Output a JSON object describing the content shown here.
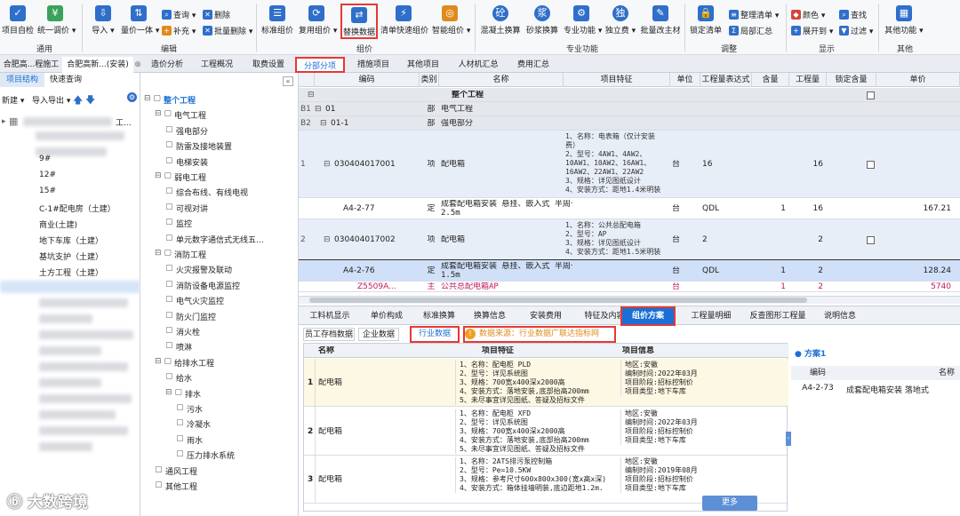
{
  "ribbon": {
    "buttons": [
      {
        "label": "项目自检",
        "icon": "check-icon"
      },
      {
        "label": "统一调价 ▾",
        "icon": "price-icon"
      },
      {
        "label": "导入 ▾",
        "icon": "import-icon"
      },
      {
        "label": "量价一体 ▾",
        "icon": "price-volume-icon"
      },
      {
        "label": "标准组价",
        "icon": "standard-pricing-icon"
      },
      {
        "label": "复用组价 ▾",
        "icon": "reuse-icon"
      },
      {
        "label": "替换数据",
        "icon": "replace-icon"
      },
      {
        "label": "清单快速组价",
        "icon": "quick-pricing-icon"
      },
      {
        "label": "智能组价 ▾",
        "icon": "smart-pricing-icon"
      },
      {
        "label": "混凝土换算",
        "icon": "concrete-icon"
      },
      {
        "label": "砂浆换算",
        "icon": "mortar-icon"
      },
      {
        "label": "专业功能 ▾",
        "icon": "pro-icon"
      },
      {
        "label": "独立费 ▾",
        "icon": "fee-icon"
      },
      {
        "label": "批量改主材",
        "icon": "batch-material-icon"
      },
      {
        "label": "锁定清单",
        "icon": "lock-icon"
      },
      {
        "label": "其他功能 ▾",
        "icon": "more-functions-icon"
      }
    ],
    "small": [
      {
        "label": "查询 ▾",
        "icon": "query-icon"
      },
      {
        "label": "删除",
        "icon": "delete-icon"
      },
      {
        "label": "补充 ▾",
        "icon": "supplement-icon"
      },
      {
        "label": "批量删除 ▾",
        "icon": "batch-delete-icon"
      },
      {
        "label": "整理清单 ▾",
        "icon": "organize-icon"
      },
      {
        "label": "局部汇总",
        "icon": "summary-icon"
      },
      {
        "label": "颜色 ▾",
        "icon": "color-icon"
      },
      {
        "label": "查找",
        "icon": "search-icon"
      },
      {
        "label": "展开到 ▾",
        "icon": "expand-icon"
      },
      {
        "label": "过滤 ▾",
        "icon": "filter-icon"
      }
    ],
    "groups": [
      "通用",
      "编辑",
      "组价",
      "专业功能",
      "调整",
      "显示",
      "其他"
    ]
  },
  "tabs": {
    "docs": [
      "合肥高...程施工",
      "合肥高新...(安装)"
    ],
    "main": [
      "造价分析",
      "工程概况",
      "取费设置",
      "分部分项",
      "措施项目",
      "其他项目",
      "人材机汇总",
      "费用汇总"
    ]
  },
  "left": {
    "tabs": [
      "项目结构",
      "快速查询"
    ],
    "toolbar": [
      "新建 ▾",
      "导入导出 ▾"
    ],
    "items": [
      "9#",
      "12#",
      "15#",
      "C-1#配电房（土建）",
      "商业(土建)",
      "地下车库（土建）",
      "基坑支护（土建）",
      "土方工程（土建）"
    ],
    "root_stub": "工..."
  },
  "tree": [
    "整个工程",
    "电气工程",
    "强电部分",
    "防雷及接地装置",
    "电梯安装",
    "弱电工程",
    "综合布线、有线电视",
    "可视对讲",
    "监控",
    "单元数字通信式无线五...",
    "消防工程",
    "火灾报警及联动",
    "消防设备电源监控",
    "电气火灾监控",
    "防火门监控",
    "消火栓",
    "喷淋",
    "给排水工程",
    "给水",
    "排水",
    "污水",
    "冷凝水",
    "雨水",
    "压力排水系统",
    "通风工程",
    "其他工程"
  ],
  "grid": {
    "headers": [
      "编码",
      "类别",
      "名称",
      "项目特征",
      "单位",
      "工程量表达式",
      "含量",
      "工程量",
      "锁定含量",
      "单价"
    ],
    "rows": [
      {
        "idx": "",
        "code": "",
        "type": "",
        "name": "整个工程",
        "feature": "",
        "unit": "",
        "expr": "",
        "content": "",
        "qty": "",
        "price": ""
      },
      {
        "idx": "B1",
        "code": "01",
        "type": "部",
        "name": "电气工程",
        "feature": "",
        "unit": "",
        "expr": "",
        "content": "",
        "qty": "",
        "price": ""
      },
      {
        "idx": "B2",
        "code": "01-1",
        "type": "部",
        "name": "强电部分",
        "feature": "",
        "unit": "",
        "expr": "",
        "content": "",
        "qty": "",
        "price": ""
      },
      {
        "idx": "1",
        "code": "030404017001",
        "type": "项",
        "name": "配电箱",
        "feature": "1、名称：电表箱（仅计安装\n费）\n2、型号：4AW1、4AW2、\n10AW1、10AW2、16AW1、\n16AW2、22AW1、22AW2\n3、规格：详见图纸设计\n4、安装方式：距地1.4米明装",
        "unit": "台",
        "expr": "16",
        "content": "",
        "qty": "16",
        "price": ""
      },
      {
        "idx": "",
        "code": "A4-2-77",
        "type": "定",
        "name": "成套配电箱安装 悬挂、嵌入式 半周长\n2.5m",
        "feature": "",
        "unit": "台",
        "expr": "QDL",
        "content": "1",
        "qty": "16",
        "price": "167.21"
      },
      {
        "idx": "2",
        "code": "030404017002",
        "type": "项",
        "name": "配电箱",
        "feature": "1、名称：公共总配电箱\n2、型号：AP\n3、规格：详见图纸设计\n4、安装方式：距地1.5米明装",
        "unit": "台",
        "expr": "2",
        "content": "",
        "qty": "2",
        "price": ""
      },
      {
        "idx": "",
        "code": "A4-2-76",
        "type": "定",
        "name": "成套配电箱安装 悬挂、嵌入式 半周长\n1.5m",
        "feature": "",
        "unit": "台",
        "expr": "QDL",
        "content": "1",
        "qty": "2",
        "price": "128.24"
      },
      {
        "idx": "",
        "code": "Z5509A...",
        "type": "主",
        "name": "公共总配电箱AP",
        "feature": "",
        "unit": "台",
        "expr": "",
        "content": "1",
        "qty": "2",
        "price": "5740"
      }
    ]
  },
  "bottom_tabs": [
    "工料机显示",
    "单价构成",
    "标准换算",
    "换算信息",
    "安装费用",
    "特征及内容",
    "组价方案",
    "工程量明细",
    "反查图形工程量",
    "说明信息"
  ],
  "source_tabs": [
    "员工存档数据",
    "企业数据",
    "行业数据"
  ],
  "source_note": "数据来源：行业数据广联达指标网",
  "scheme": {
    "headers": [
      "名称",
      "项目特征",
      "项目信息"
    ],
    "rows": [
      {
        "idx": "1",
        "name": "配电箱",
        "feature": "1、名称：配电柜 PLD\n2、型号：详见系统图\n3、规格：700宽x400深x2000高\n4、安装方式：落地安装,底部抬高200mm\n5、未尽事宜详见图纸、答疑及招标文件",
        "info": "地区:安徽\n编制时间:2022年03月\n项目阶段:招标控制价\n项目类型:地下车库"
      },
      {
        "idx": "2",
        "name": "配电箱",
        "feature": "1、名称：配电柜 XFD\n2、型号：详见系统图\n3、规格：700宽x400深x2000高\n4、安装方式：落地安装,底部抬高200mm\n5、未尽事宜详见图纸、答疑及招标文件",
        "info": "地区:安徽\n编制时间:2022年03月\n项目阶段:招标控制价\n项目类型:地下车库"
      },
      {
        "idx": "3",
        "name": "配电箱",
        "feature": "1、名称：2ATS排污泵控制箱\n2、型号：Pe=10.5KW\n3、规格：参考尺寸600x800x300(宽x高x深)\n4、安装方式：箱体挂墙明装,底边距地1.2m.",
        "info": "地区:安徽\n编制时间:2019年08月\n项目阶段:招标控制价\n项目类型:地下车库"
      }
    ],
    "more": "更多"
  },
  "plan": {
    "title": "方案1",
    "headers": [
      "编码",
      "名称"
    ],
    "code": "A4-2-73",
    "name": "成套配电箱安装 落地式"
  },
  "watermark": "大数跨境"
}
